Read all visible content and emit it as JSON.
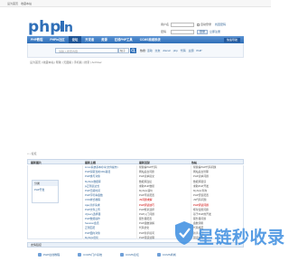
{
  "topbar": {
    "links": [
      "设为首页",
      "收藏本站"
    ]
  },
  "logo": {
    "text": "php",
    "accent": "#2f6fb8",
    "mark": "n"
  },
  "login": {
    "user_label": "用户名",
    "pass_label": "密码",
    "auto_login": "自动登录",
    "find_password": "找回密码",
    "login_button": "登录",
    "register_link": "立即注册"
  },
  "nav": {
    "items": [
      "PHP教程",
      "PHPin社区",
      "论坛",
      "开发者",
      "资源",
      "在线PHP工具",
      "CCMS商城系统"
    ],
    "active_index": 2,
    "right_label": "快速导航"
  },
  "search": {
    "placeholder": "请输入搜索内容",
    "type": "帖子",
    "hot_label": "热搜:",
    "hot_terms": [
      "活动",
      "交友",
      "discuz",
      "php",
      "代码",
      "主题",
      "PHP"
    ]
  },
  "notice": "设为首页 | 收藏本站 | 帮助 | 无图版 | 手机版 | 搜索 | Archiver",
  "breadcrumb": "论坛",
  "forum": {
    "columns": [
      "最新图片",
      "最新主题",
      "最新回复",
      "热帖"
    ],
    "catbox": {
      "title": "分类",
      "item": "PHP开发"
    },
    "col2": [
      "Linux系统基本命令(文件操作)",
      "PHP获取当前URL路径",
      "PHP类与对象",
      "MySQL数据库",
      "js正则表达式",
      "PHP日期时间",
      "PHP字符串函数",
      "CSS样式教程",
      "Ajax异步请求",
      "PHP文件上传",
      "JQuery选择器",
      "PHP数组操作",
      "Session会话",
      "正则匹配",
      "PHP面向对象",
      "MySQL优化"
    ],
    "col3": [
      "帮我看PHP代码",
      "网站后台问题",
      "PHP表单提交",
      "数据库连接",
      "求助PHP数组",
      "MySQL语句",
      "PHP环境配置",
      "JS问题求解",
      "PHP调试技巧",
      "PHP框架选择",
      "PHP入门问题",
      "服务器配置",
      "PHP函数讲解",
      "代码优化",
      "PHP新手提问",
      "PHP错误处理"
    ],
    "col4": [
      "帮我看PHP代码问题",
      "网站后台管理",
      "PHP表单问题",
      "数据库错误",
      "求助PHP开发",
      "MySQL查询",
      "PHP安装配置",
      "JS代码问题",
      "PHP调试问题",
      "框架使用问题",
      "基于PHP的开发",
      "服务器问题",
      "函数调用",
      "代码规范",
      "新手入门",
      "错误排查"
    ]
  },
  "links": {
    "title": "友情链接",
    "items": [
      "PHP在线教程",
      "CCMS门户系统",
      "CCMS论坛",
      "CCMS商城"
    ]
  },
  "watermark": {
    "text": "星链秒收录",
    "color": "#3b8de0"
  }
}
